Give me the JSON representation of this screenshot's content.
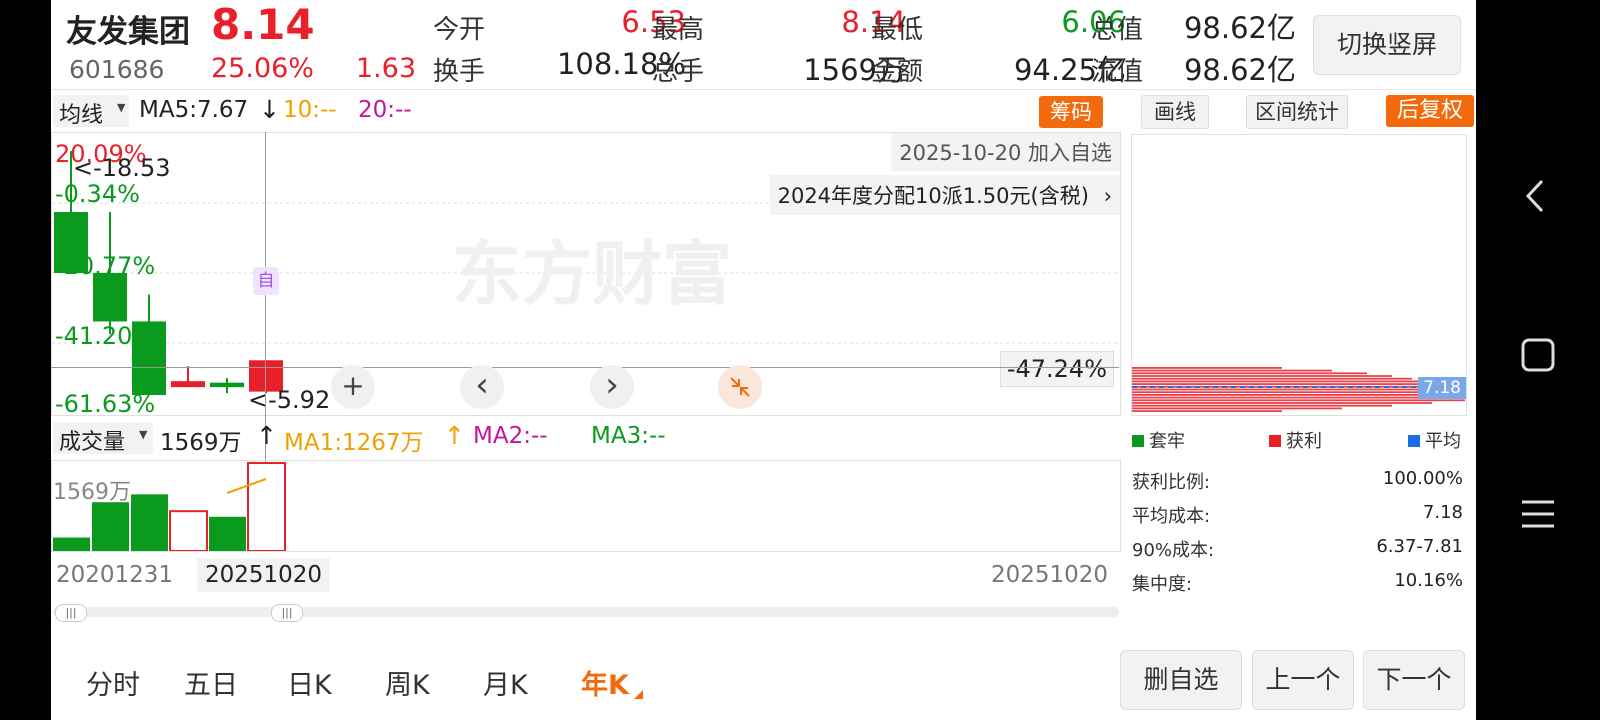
{
  "stock": {
    "name": "友发集团",
    "price": "8.14",
    "code": "601686",
    "change_pct": "25.06%",
    "change": "1.63"
  },
  "quote": [
    {
      "label": "今开",
      "value": "6.53",
      "color": "#e8202a"
    },
    {
      "label": "最高",
      "value": "8.14",
      "color": "#e8202a"
    },
    {
      "label": "最低",
      "value": "6.06",
      "color": "#0a9a1e"
    },
    {
      "label": "总值",
      "value": "98.62亿",
      "color": "#222"
    },
    {
      "label": "换手",
      "value": "108.18%",
      "color": "#222"
    },
    {
      "label": "总手",
      "value": "1569万",
      "color": "#222"
    },
    {
      "label": "金额",
      "value": "94.25亿",
      "color": "#222"
    },
    {
      "label": "流值",
      "value": "98.62亿",
      "color": "#222"
    }
  ],
  "switch_button": "切换竖屏",
  "ma_bar": {
    "type": "均线",
    "ma5": "MA5:7.67",
    "ma5_arrow": "↓",
    "ma10": "10:--",
    "ma20": "20:--",
    "chip_btn": "筹码"
  },
  "right_tools": {
    "draw": "画线",
    "range_stats": "区间统计",
    "adjust": "后复权"
  },
  "chart": {
    "watchlist_note": "2025-10-20 加入自选",
    "dividend_note": "2024年度分配10派1.50元(含税)",
    "watermark": "东方财富",
    "ylabels": [
      "20.09%",
      "-0.34%",
      "-20.77%",
      "-41.20%",
      "-61.63%"
    ],
    "high_marker": "<-18.53",
    "low_marker": "<-5.92",
    "crosshair_value": "-47.24%",
    "self_tag": "自",
    "plus": "+",
    "prev": "‹",
    "next": "›"
  },
  "volume_bar": {
    "type": "成交量",
    "vol": "1569万",
    "vol_arrow": "↑",
    "ma1": "MA1:1267万",
    "ma1_arrow": "↑",
    "ma2": "MA2:--",
    "ma3": "MA3:--",
    "axis_label": "1569万"
  },
  "chart_data": {
    "type": "candlestick",
    "xlabels": [
      "20201231",
      "20251020"
    ],
    "y_axis": "percent",
    "candles": [
      {
        "open": -0.34,
        "close": -20.77,
        "high": 20.09,
        "low": -20.77,
        "color": "green"
      },
      {
        "open": -20.77,
        "close": -37.0,
        "high": -0.34,
        "low": -41.2,
        "color": "green"
      },
      {
        "open": -37.0,
        "close": -61.63,
        "high": -28.0,
        "low": -61.63,
        "color": "green"
      },
      {
        "open": -57.0,
        "close": -59.0,
        "high": -52.0,
        "low": -59.0,
        "color": "red"
      },
      {
        "open": -59.0,
        "close": -57.5,
        "high": -56.0,
        "low": -61.0,
        "color": "green"
      },
      {
        "open": -50.0,
        "close": -60.5,
        "high": -50.0,
        "low": -61.0,
        "color": "red"
      }
    ],
    "volume": [
      {
        "value": 240,
        "color": "green"
      },
      {
        "value": 870,
        "color": "green"
      },
      {
        "value": 1010,
        "color": "green"
      },
      {
        "value": 710,
        "color": "red"
      },
      {
        "value": 610,
        "color": "green"
      },
      {
        "value": 1569,
        "color": "red"
      }
    ]
  },
  "date_start": "20201231",
  "date_cursor": "20251020",
  "date_end": "20251020",
  "chip": {
    "legend": [
      {
        "label": "套牢",
        "color": "#0a9a1e"
      },
      {
        "label": "获利",
        "color": "#e8202a"
      },
      {
        "label": "平均",
        "color": "#1e6be6"
      }
    ],
    "avg_label": "7.18",
    "stats": [
      {
        "label": "获利比例:",
        "value": "100.00%"
      },
      {
        "label": "平均成本:",
        "value": "7.18"
      },
      {
        "label": "90%成本:",
        "value": "6.37-7.81"
      },
      {
        "label": "集中度:",
        "value": "10.16%"
      }
    ]
  },
  "periods": [
    "分时",
    "五日",
    "日K",
    "周K",
    "月K",
    "年K"
  ],
  "active_period": "年K",
  "bottom_buttons": [
    "删自选",
    "上一个",
    "下一个"
  ]
}
